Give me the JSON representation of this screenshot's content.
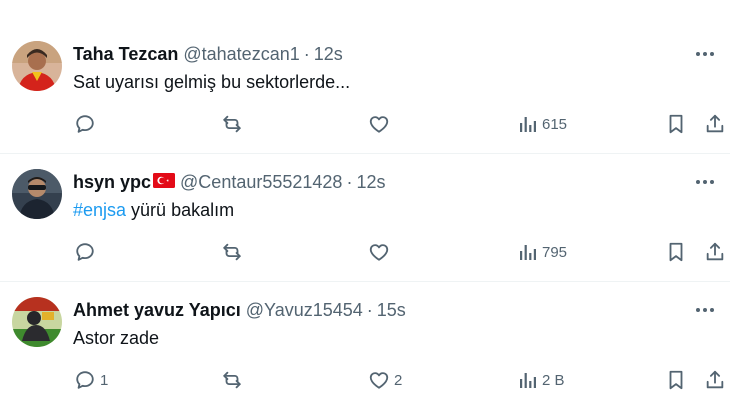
{
  "tweets": [
    {
      "name": "Taha Tezcan",
      "handle": "@tahatezcan1",
      "separator": "·",
      "time": "12s",
      "text": "Sat uyarısı gelmiş bu sektorlerde...",
      "replies": "",
      "retweets": "",
      "likes": "",
      "views": "615"
    },
    {
      "name": "hsyn ypc",
      "handle": "@Centaur55521428",
      "separator": "·",
      "time": "12s",
      "hashtag": "#enjsa",
      "text_after": " yürü bakalım",
      "replies": "",
      "retweets": "",
      "likes": "",
      "views": "795"
    },
    {
      "name": "Ahmet yavuz Yapıcı",
      "handle": "@Yavuz15454",
      "separator": "·",
      "time": "15s",
      "text": "Astor zade",
      "replies": "1",
      "retweets": "",
      "likes": "2",
      "views": "2 B"
    }
  ],
  "icons": {
    "more": "more-horizontal-icon",
    "reply": "reply-icon",
    "retweet": "retweet-icon",
    "like": "heart-icon",
    "views": "views-icon",
    "bookmark": "bookmark-icon",
    "share": "share-icon"
  },
  "colors": {
    "text": "#0f1419",
    "secondary": "#536471",
    "hashtag": "#1d9bf0",
    "divider": "#eff3f4"
  }
}
